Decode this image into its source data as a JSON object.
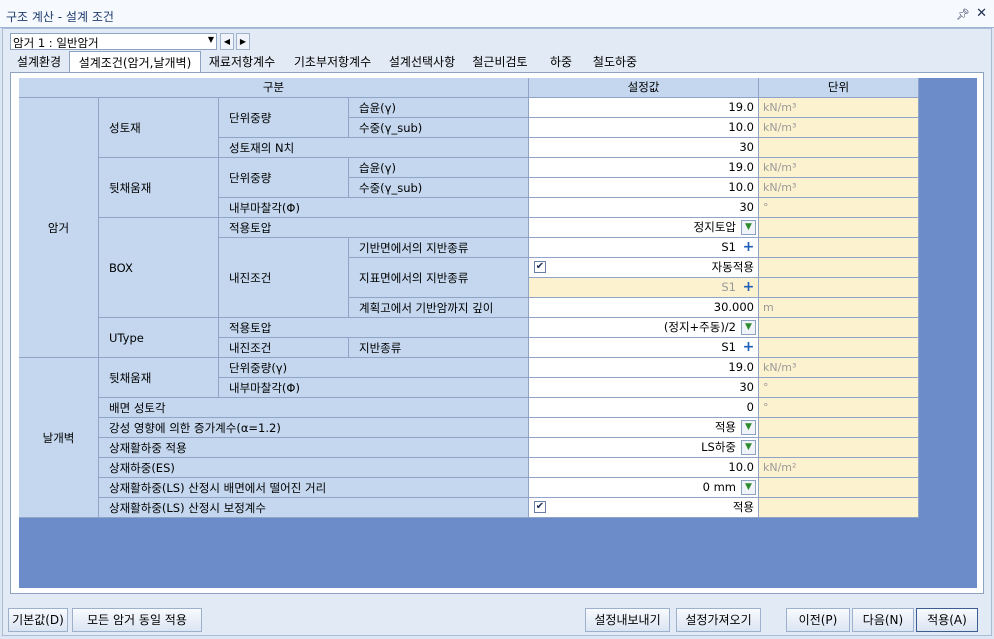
{
  "window": {
    "title": "구조 계산 - 설계 조건",
    "pin": "ᅟ",
    "close": "✕"
  },
  "selector": {
    "value": "암거 1 : 일반암거"
  },
  "tabs": [
    "설계환경",
    "설계조건(암거,날개벽)",
    "재료저항계수",
    "기초부저항계수",
    "설계선택사항",
    "철근비검토",
    "하중",
    "철도하중"
  ],
  "headers": {
    "group": "구분",
    "value": "설정값",
    "unit": "단위"
  },
  "sections": {
    "amgeo": "암거",
    "wing": "날개벽"
  },
  "rows": {
    "r1": {
      "l1": "성토재",
      "l2": "단위중량",
      "l3": "습윤(γ)",
      "val": "19.0",
      "unit": "kN/m³"
    },
    "r2": {
      "l3": "수중(γ_sub)",
      "val": "10.0",
      "unit": "kN/m³"
    },
    "r3": {
      "l2": "성토재의 N치",
      "val": "30",
      "unit": ""
    },
    "r4": {
      "l1": "뒷채움재",
      "l2": "단위중량",
      "l3": "습윤(γ)",
      "val": "19.0",
      "unit": "kN/m³"
    },
    "r5": {
      "l3": "수중(γ_sub)",
      "val": "10.0",
      "unit": "kN/m³"
    },
    "r6": {
      "l2": "내부마찰각(Φ)",
      "val": "30",
      "unit": "°"
    },
    "r7": {
      "l1": "BOX",
      "l2": "적용토압",
      "val": "정지토압",
      "unit": ""
    },
    "r8": {
      "l2": "내진조건",
      "l3": "기반면에서의 지반종류",
      "val": "S1",
      "unit": ""
    },
    "r9": {
      "l3": "지표면에서의 지반종류",
      "val": "자동적용",
      "unit": ""
    },
    "r10": {
      "val": "S1",
      "unit": ""
    },
    "r11": {
      "l3": "계획고에서 기반암까지 깊이",
      "val": "30.000",
      "unit": "m"
    },
    "r12": {
      "l1": "UType",
      "l2": "적용토압",
      "val": "(정지+주동)/2",
      "unit": ""
    },
    "r13": {
      "l2": "내진조건",
      "l3": "지반종류",
      "val": "S1",
      "unit": ""
    },
    "r14": {
      "l1": "뒷채움재",
      "l2": "단위중량(γ)",
      "val": "19.0",
      "unit": "kN/m³"
    },
    "r15": {
      "l2": "내부마찰각(Φ)",
      "val": "30",
      "unit": "°"
    },
    "r16": {
      "l1": "배면 성토각",
      "val": "0",
      "unit": "°"
    },
    "r17": {
      "l1": "강성 영향에 의한 증가계수(α=1.2)",
      "val": "적용",
      "unit": ""
    },
    "r18": {
      "l1": "상재활하중 적용",
      "val": "LS하중",
      "unit": ""
    },
    "r19": {
      "l1": "상재하중(ES)",
      "val": "10.0",
      "unit": "kN/m²"
    },
    "r20": {
      "l1": "상재활하중(LS) 산정시 배면에서 떨어진 거리",
      "val": "0 mm",
      "unit": ""
    },
    "r21": {
      "l1": "상재활하중(LS) 산정시 보정계수",
      "val": "적용",
      "unit": ""
    }
  },
  "buttons": {
    "default": "기본값(D)",
    "apply_all": "모든 암거 동일 적용",
    "export": "설정내보내기",
    "import": "설정가져오기",
    "prev": "이전(P)",
    "next": "다음(N)",
    "apply": "적용(A)"
  }
}
